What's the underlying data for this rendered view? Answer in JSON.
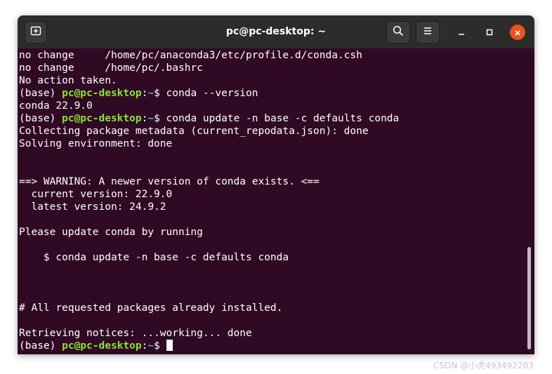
{
  "window": {
    "title": "pc@pc-desktop: ~"
  },
  "toolbar": {
    "new_tab_icon": "new-tab-icon",
    "search_icon": "search-icon",
    "menu_icon": "hamburger-menu-icon",
    "minimize_icon": "minimize-icon",
    "maximize_icon": "maximize-icon",
    "close_icon": "close-icon"
  },
  "colors": {
    "terminal_background": "#300a24",
    "titlebar": "#2c2c2c",
    "prompt_user": "#8ae234",
    "prompt_path": "#729fcf",
    "close_button": "#e95420"
  },
  "terminal": {
    "lines": {
      "l01": "no change     /home/pc/anaconda3/etc/profile.d/conda.csh",
      "l02": "no change     /home/pc/.bashrc",
      "l03": "No action taken.",
      "l04_env": "(base) ",
      "l04_user": "pc@pc-desktop",
      "l04_sep": ":",
      "l04_path": "~",
      "l04_cmd": "$ conda --version",
      "l05": "conda 22.9.0",
      "l06_env": "(base) ",
      "l06_user": "pc@pc-desktop",
      "l06_sep": ":",
      "l06_path": "~",
      "l06_cmd": "$ conda update -n base -c defaults conda",
      "l07": "Collecting package metadata (current_repodata.json): done",
      "l08": "Solving environment: done",
      "l09": "",
      "l10": "",
      "l11": "==> WARNING: A newer version of conda exists. <==",
      "l12": "  current version: 22.9.0",
      "l13": "  latest version: 24.9.2",
      "l14": "",
      "l15": "Please update conda by running",
      "l16": "",
      "l17": "    $ conda update -n base -c defaults conda",
      "l18": "",
      "l19": "",
      "l20": "",
      "l21": "# All requested packages already installed.",
      "l22": "",
      "l23": "Retrieving notices: ...working... done",
      "l24_env": "(base) ",
      "l24_user": "pc@pc-desktop",
      "l24_sep": ":",
      "l24_path": "~",
      "l24_cmd": "$ "
    }
  },
  "watermark": "CSDN @小虎493492203"
}
